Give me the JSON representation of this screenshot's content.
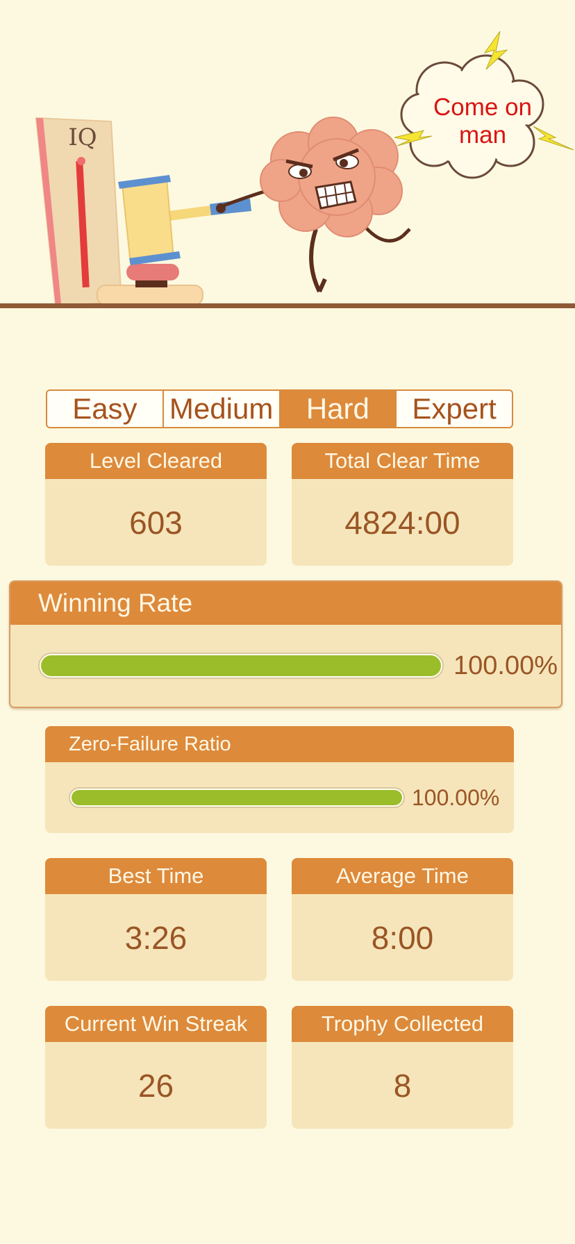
{
  "hero": {
    "iq_label": "IQ",
    "speech_line1": "Come on",
    "speech_line2": "man"
  },
  "tabs": [
    {
      "label": "Easy",
      "active": false
    },
    {
      "label": "Medium",
      "active": false
    },
    {
      "label": "Hard",
      "active": true
    },
    {
      "label": "Expert",
      "active": false
    }
  ],
  "stats": {
    "level_cleared": {
      "label": "Level Cleared",
      "value": "603"
    },
    "total_clear_time": {
      "label": "Total Clear Time",
      "value": "4824:00"
    },
    "winning_rate": {
      "label": "Winning Rate",
      "value": "100.00%",
      "fraction": 1.0
    },
    "zero_failure_ratio": {
      "label": "Zero-Failure Ratio",
      "value": "100.00%",
      "fraction": 1.0
    },
    "best_time": {
      "label": "Best Time",
      "value": "3:26"
    },
    "average_time": {
      "label": "Average Time",
      "value": "8:00"
    },
    "current_win_streak": {
      "label": "Current Win Streak",
      "value": "26"
    },
    "trophy_collected": {
      "label": "Trophy Collected",
      "value": "8"
    }
  },
  "colors": {
    "accent": "#dd8a3b",
    "card_bg": "#f6e5bb",
    "page_bg": "#fdf9e0",
    "bar_fill": "#9bbd2a",
    "value_text": "#9a5524",
    "speech_text": "#d91414"
  }
}
